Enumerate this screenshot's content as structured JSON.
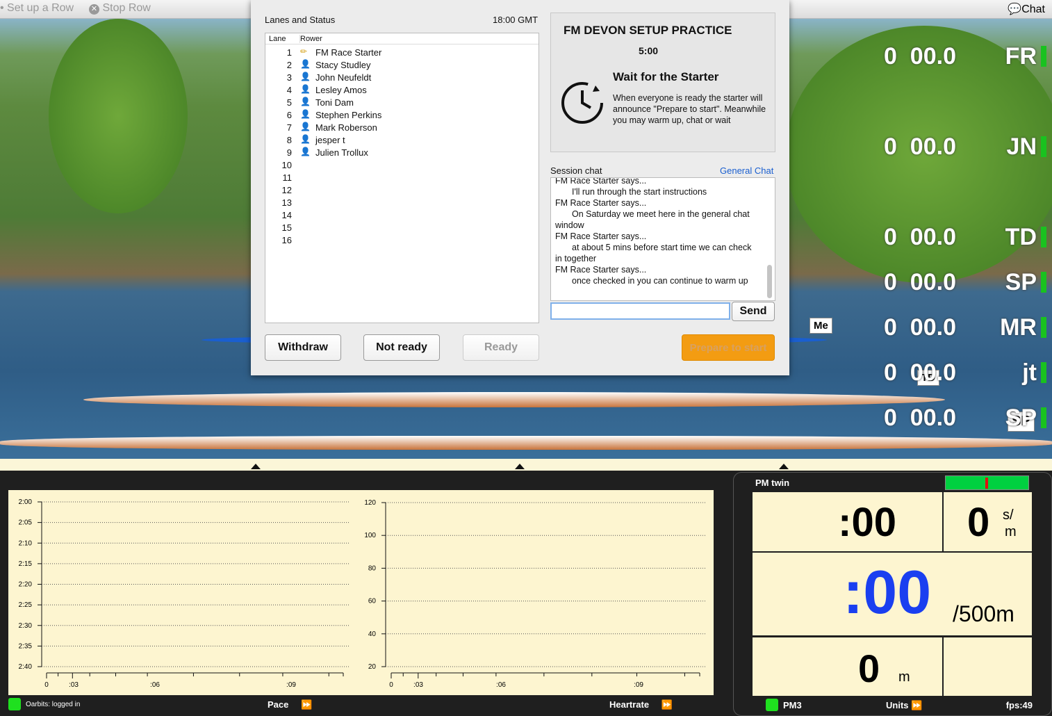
{
  "topbar": {
    "setup_label": "Set up a Row",
    "stop_label": "Stop Row",
    "chat_label": "Chat"
  },
  "leaderboard": [
    {
      "time": "0  00.0",
      "initials": "FR"
    },
    {
      "time": "0  00.0",
      "initials": "JN"
    },
    {
      "time": "0  00.0",
      "initials": "TD"
    },
    {
      "time": "0  00.0",
      "initials": "SP"
    },
    {
      "time": "0  00.0",
      "initials": "MR"
    },
    {
      "time": "0  00.0",
      "initials": "jt"
    },
    {
      "time": "0  00.0",
      "initials": "SP"
    }
  ],
  "boat_tags": [
    "Me",
    "TD",
    "SP"
  ],
  "dialog": {
    "lanes_title": "Lanes and Status",
    "clock": "18:00 GMT",
    "col_lane": "Lane",
    "col_rower": "Rower",
    "lanes": [
      {
        "lane": "1",
        "rower": "FM Race  Starter",
        "icon": "pencil"
      },
      {
        "lane": "2",
        "rower": "Stacy Studley",
        "icon": "user-grey"
      },
      {
        "lane": "3",
        "rower": "John Neufeldt",
        "icon": "user-blue"
      },
      {
        "lane": "4",
        "rower": "Lesley Amos",
        "icon": "user-grey"
      },
      {
        "lane": "5",
        "rower": "Toni Dam",
        "icon": "user-red"
      },
      {
        "lane": "6",
        "rower": "Stephen Perkins",
        "icon": "user-blue"
      },
      {
        "lane": "7",
        "rower": "Mark Roberson",
        "icon": "user-blue"
      },
      {
        "lane": "8",
        "rower": "jesper t",
        "icon": "user-blue"
      },
      {
        "lane": "9",
        "rower": "Julien Trollux",
        "icon": "user-blue"
      },
      {
        "lane": "10",
        "rower": ""
      },
      {
        "lane": "11",
        "rower": ""
      },
      {
        "lane": "12",
        "rower": ""
      },
      {
        "lane": "13",
        "rower": ""
      },
      {
        "lane": "14",
        "rower": ""
      },
      {
        "lane": "15",
        "rower": ""
      },
      {
        "lane": "16",
        "rower": ""
      }
    ],
    "withdraw": "Withdraw",
    "not_ready": "Not ready",
    "ready": "Ready",
    "session_title": "FM DEVON SETUP PRACTICE",
    "session_time": "5:00",
    "wait_title": "Wait for the Starter",
    "wait_text": "When everyone is ready the starter will announce \"Prepare to start\". Meanwhile you may warm up, chat or wait",
    "chat_label": "Session chat",
    "general_chat": "General Chat",
    "chat_lines": [
      {
        "who": "FM Race  Starter says...",
        "msg": "I'll run through the start instructions"
      },
      {
        "who": "FM Race  Starter says...",
        "msg": "On Saturday we meet here in the general chat window"
      },
      {
        "who": "FM Race  Starter says...",
        "msg": "at about 5 mins before start time we can check in together"
      },
      {
        "who": "FM Race  Starter says...",
        "msg": "once checked in you can continue to warm up"
      }
    ],
    "chat_input": "",
    "send": "Send",
    "prepare": "Prepare to start",
    "accent": "#f39c12"
  },
  "chart_data": [
    {
      "type": "line",
      "title": "",
      "yticks": [
        "2:00",
        "2:05",
        "2:10",
        "2:15",
        "2:20",
        "2:25",
        "2:30",
        "2:35",
        "2:40"
      ],
      "xticks": [
        "0",
        ":03",
        ":06",
        ":09"
      ],
      "series": []
    },
    {
      "type": "line",
      "title": "",
      "yticks": [
        "120",
        "100",
        "80",
        "60",
        "40",
        "20"
      ],
      "xticks": [
        "0",
        ":03",
        ":06",
        ":09"
      ],
      "series": []
    }
  ],
  "charts_footer": {
    "status": "Oarbits: logged in",
    "pace": "Pace",
    "heartrate": "Heartrate"
  },
  "pm": {
    "title": "PM twin",
    "time": ":00",
    "rate": "0",
    "rate_unit_top": "s/",
    "rate_unit_bottom": "m",
    "pace": ":00",
    "pace_unit": "/500m",
    "distance": "0",
    "distance_unit": "m",
    "device": "PM3",
    "units": "Units",
    "fps": "fps:49",
    "pace_color": "#1a3ff0"
  }
}
